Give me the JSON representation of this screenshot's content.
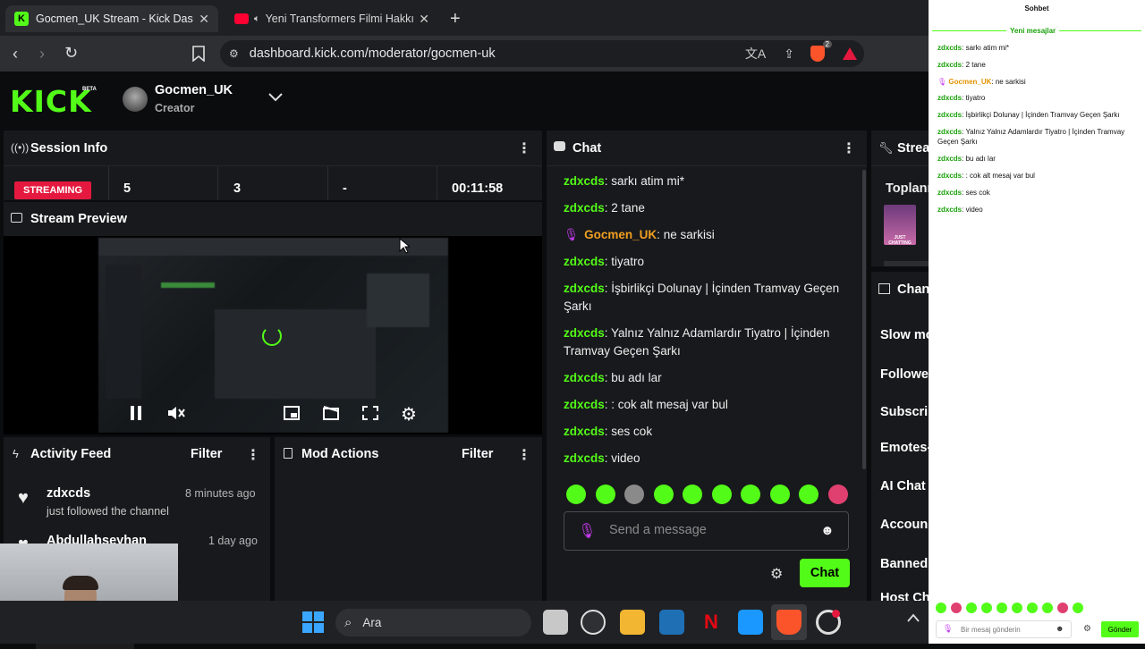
{
  "browser": {
    "tabs": [
      {
        "title": "Gocmen_UK Stream - Kick Dashboard"
      },
      {
        "title": "Yeni Transformers Filmi Hakkında"
      }
    ],
    "url": "dashboard.kick.com/moderator/gocmen-uk",
    "extension_badge": "2"
  },
  "header": {
    "logo": "KICK",
    "logo_badge": "BETA",
    "channel_name": "Gocmen_UK",
    "channel_role": "Creator"
  },
  "session": {
    "title": "Session Info",
    "status": "STREAMING",
    "viewers": "5",
    "followers": "3",
    "subs": "-",
    "uptime": "00:11:58"
  },
  "preview": {
    "title": "Stream Preview"
  },
  "activity": {
    "title": "Activity Feed",
    "filter": "Filter",
    "items": [
      {
        "user": "zdxcds",
        "time": "8 minutes ago",
        "text": "just followed the channel"
      },
      {
        "user": "Abdullahseyhan",
        "time": "1 day ago",
        "text": ""
      }
    ]
  },
  "mod": {
    "title": "Mod Actions",
    "filter": "Filter"
  },
  "chat": {
    "title": "Chat",
    "messages": [
      {
        "user": "zdxcds",
        "text": "sarkı atim mi*",
        "mod": false
      },
      {
        "user": "zdxcds",
        "text": "2 tane",
        "mod": false
      },
      {
        "user": "Gocmen_UK",
        "text": "ne sarkisi",
        "mod": true
      },
      {
        "user": "zdxcds",
        "text": "tiyatro",
        "mod": false
      },
      {
        "user": "zdxcds",
        "text": "İşbirlikçi Dolunay | İçinden Tramvay Geçen Şarkı",
        "mod": false
      },
      {
        "user": "zdxcds",
        "text": "Yalnız Yalnız Adamlardır Tiyatro | İçinden Tramvay Geçen Şarkı",
        "mod": false
      },
      {
        "user": "zdxcds",
        "text": "bu adı lar",
        "mod": false
      },
      {
        "user": "zdxcds",
        "text": ": cok alt mesaj var bul",
        "mod": false
      },
      {
        "user": "zdxcds",
        "text": "ses cok",
        "mod": false
      },
      {
        "user": "zdxcds",
        "text": "video",
        "mod": false
      }
    ],
    "placeholder": "Send a message",
    "send_label": "Chat"
  },
  "stream_panel": {
    "title": "Strea",
    "category_label": "Toplanı",
    "category_tag": "JUST CHATTING"
  },
  "channel_panel": {
    "title": "Chan",
    "items": [
      "Slow mo",
      "Followe",
      "Subscri",
      "Emotes-",
      "AI Chat I",
      "Accoun",
      "Banned",
      "Host Ch"
    ]
  },
  "sidebar": {
    "title": "Sohbet",
    "new_messages": "Yeni mesajlar",
    "placeholder": "Bir mesaj gönderin",
    "send_label": "Gönder"
  },
  "taskbar": {
    "search_label": "Ara"
  },
  "colors": {
    "accent": "#53fc18",
    "live": "#e5193f",
    "panel": "#18191c"
  }
}
